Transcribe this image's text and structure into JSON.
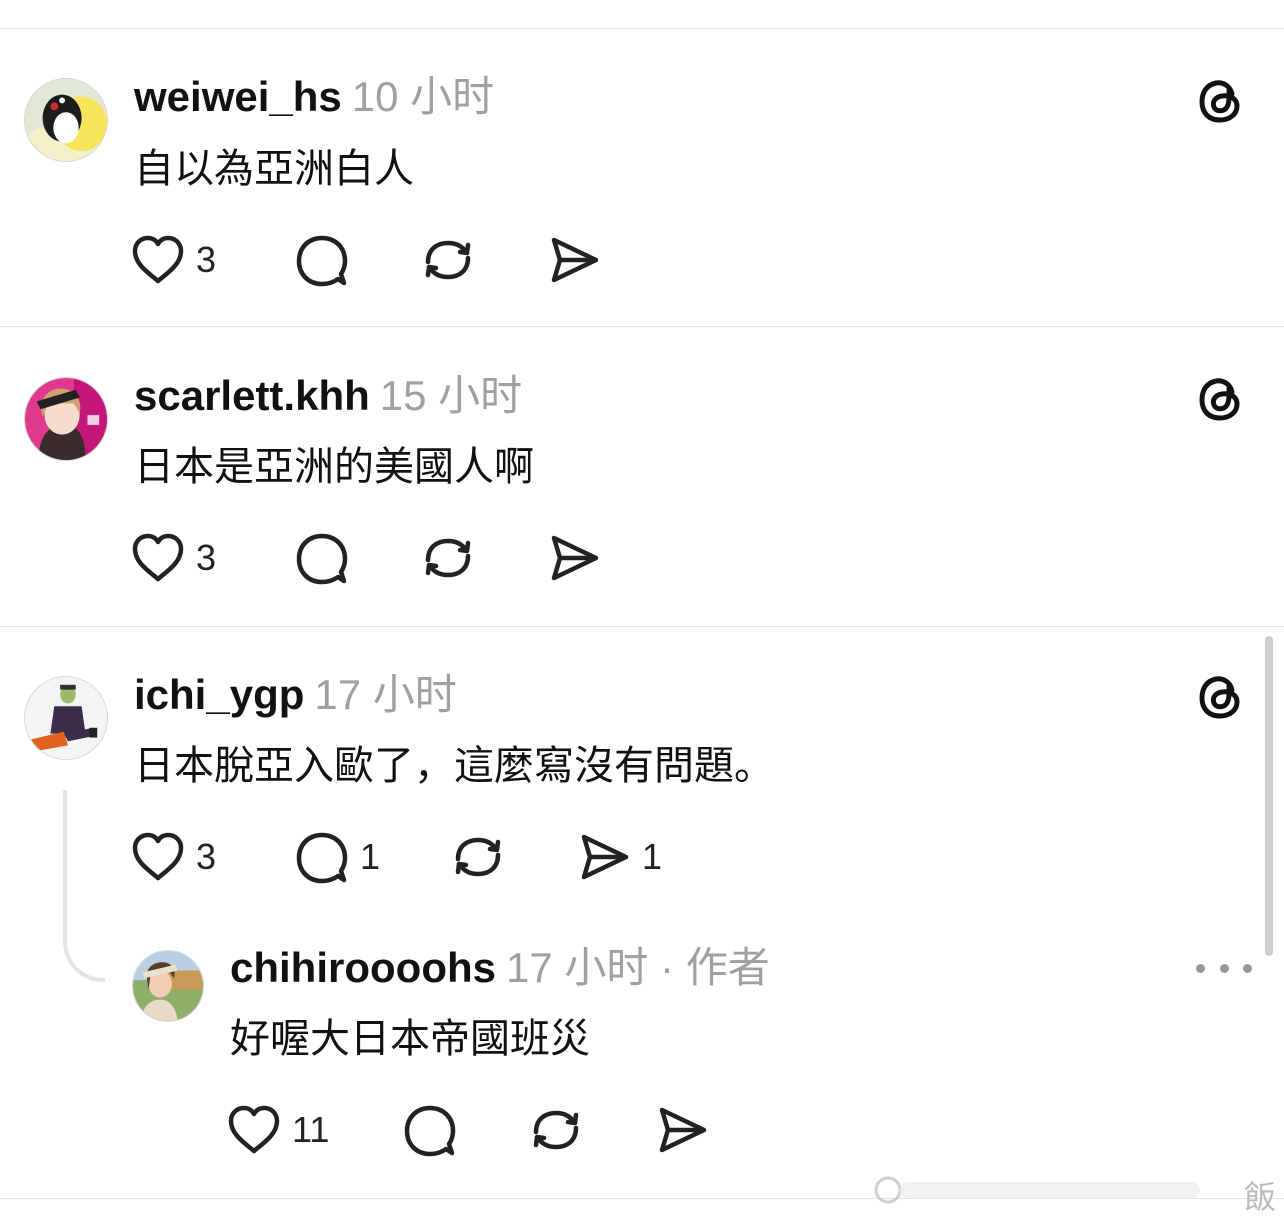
{
  "posts": [
    {
      "username": "weiwei_hs",
      "time": "10 小时",
      "text": "自以為亞洲白人",
      "likes": "3",
      "replies": "",
      "shares": ""
    },
    {
      "username": "scarlett.khh",
      "time": "15 小时",
      "text": "日本是亞洲的美國人啊",
      "likes": "3",
      "replies": "",
      "shares": ""
    },
    {
      "username": "ichi_ygp",
      "time": "17 小时",
      "text": "日本脫亞入歐了，這麼寫沒有問題。",
      "likes": "3",
      "replies": "1",
      "shares": "1"
    }
  ],
  "reply": {
    "username": "chihiroooohs",
    "time": "17 小时 · 作者",
    "text": "好喔大日本帝國班災",
    "likes": "11"
  },
  "watermark": {
    "text": "飯"
  },
  "icons": {
    "like": "heart-icon",
    "comment": "comment-bubble-icon",
    "repost": "repost-icon",
    "share": "send-icon",
    "brand": "threads-logo-icon",
    "menu": "more-dots-icon"
  },
  "colors": {
    "text": "#111111",
    "muted": "#a0a0a0",
    "divider": "#e2e2e2",
    "icon": "#222222"
  }
}
